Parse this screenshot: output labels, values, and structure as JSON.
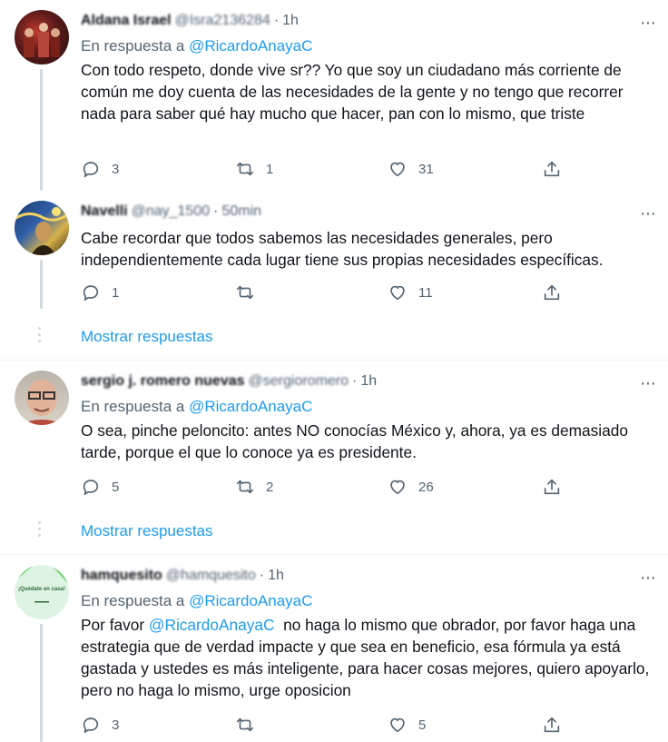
{
  "tweets": [
    {
      "name": "Aldana Israel",
      "handle": "@Isra2136284",
      "dot": "·",
      "time": "1h",
      "reply_prefix": "En respuesta a ",
      "reply_mention": "@RicardoAnayaC",
      "text": "Con todo respeto, donde vive sr??  Yo que soy un ciudadano más corriente de común me doy cuenta de las necesidades de la gente y no tengo que recorrer nada para saber qué hay mucho que hacer, pan con lo mismo, que triste",
      "replies": "3",
      "retweets": "1",
      "likes": "31"
    },
    {
      "name": "Navelli",
      "handle": "@nay_1500",
      "dot": "·",
      "time": "50min",
      "text": "Cabe recordar que todos sabemos las necesidades generales, pero independientemente cada lugar tiene sus propias necesidades específicas.",
      "replies": "1",
      "retweets": "",
      "likes": "11"
    },
    {
      "name": "sergio j. romero nuevas",
      "handle": "@sergioromero",
      "dot": "·",
      "time": "1h",
      "reply_prefix": "En respuesta a ",
      "reply_mention": "@RicardoAnayaC",
      "text": "O sea, pinche peloncito: antes NO conocías México y, ahora, ya es demasiado tarde, porque el que lo conoce ya es presidente.",
      "replies": "5",
      "retweets": "2",
      "likes": "26"
    },
    {
      "name": "hamquesito",
      "handle": "@hamquesito",
      "dot": "·",
      "time": "1h",
      "reply_prefix": "En respuesta a ",
      "reply_mention": "@RicardoAnayaC",
      "text_mention": "@RicardoAnayaC",
      "text_prefix": "Por favor ",
      "text": "  no haga lo mismo que obrador, por favor haga una estrategia que de verdad impacte y que sea en beneficio, esa fórmula ya está gastada y ustedes es más inteligente, para hacer cosas mejores, quiero apoyarlo, pero no haga lo mismo, urge oposicion",
      "replies": "3",
      "retweets": "",
      "likes": "5",
      "avatar_text": "¡Quédate en casa!"
    }
  ],
  "show_replies_label": "Mostrar respuestas",
  "more_icon": "···",
  "colors": {
    "accent": "#1d9bf0",
    "secondary": "#536471",
    "line": "#cfd9de"
  }
}
